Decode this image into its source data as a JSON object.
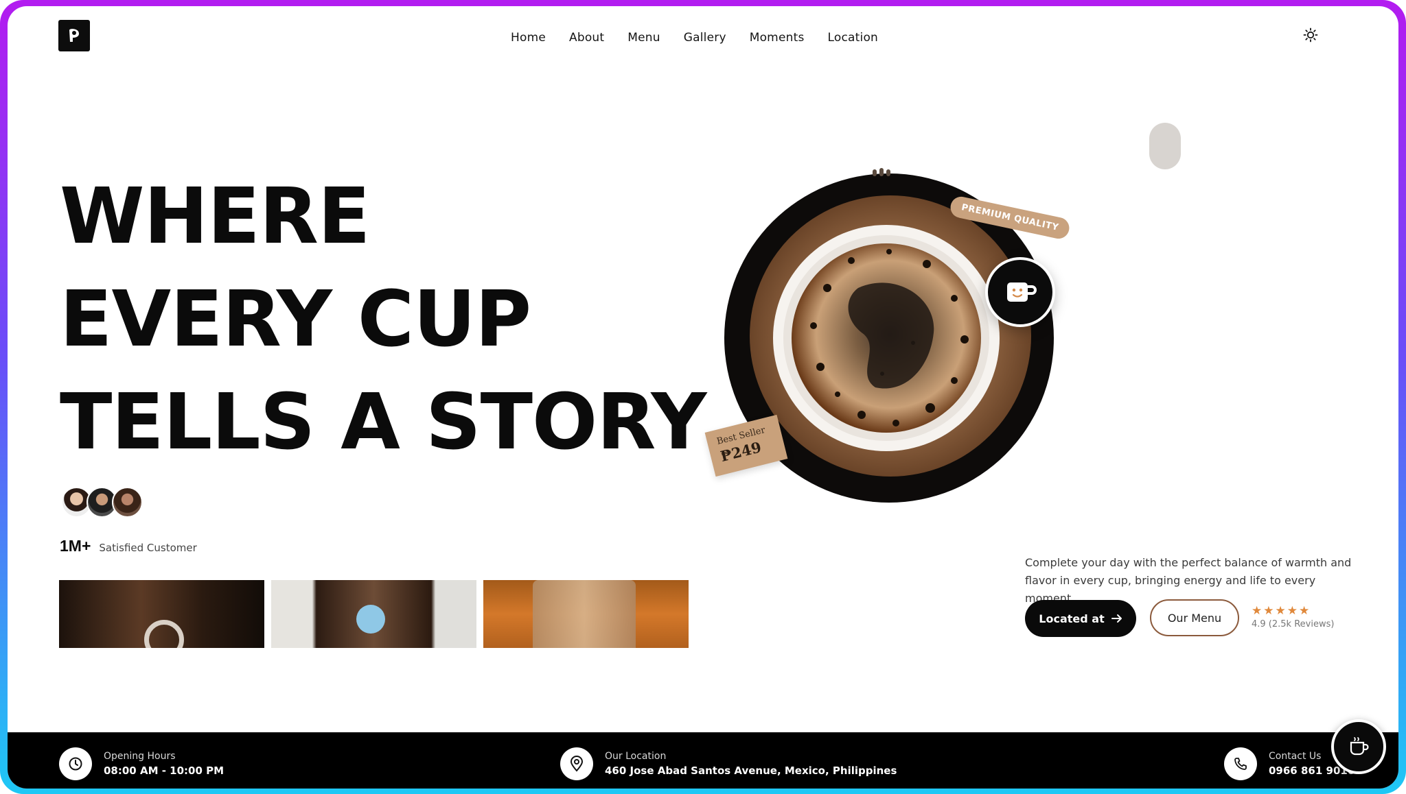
{
  "nav": {
    "items": [
      "Home",
      "About",
      "Menu",
      "Gallery",
      "Moments",
      "Location"
    ]
  },
  "hero": {
    "title_lines": [
      "WHERE",
      "EVERY CUP",
      "TELLS A STORY"
    ],
    "stat_number": "1M+",
    "stat_label": "Satisfied Customer"
  },
  "visual": {
    "premium_badge": "PREMIUM QUALITY",
    "bestseller_label": "Best Seller",
    "bestseller_price": "₱249"
  },
  "intro": {
    "description": "Complete your day with the perfect balance of warmth and flavor in every cup, bringing energy and life to every moment.",
    "located_button": "Located at",
    "menu_button": "Our Menu",
    "stars": "★★★★★",
    "rating_text": "4.9 (2.5k Reviews)"
  },
  "footer": {
    "hours_label": "Opening Hours",
    "hours_value": "08:00 AM - 10:00 PM",
    "location_label": "Our Location",
    "location_value": "460 Jose Abad Santos Avenue, Mexico, Philippines",
    "contact_label": "Contact Us",
    "contact_value": "0966 861 9010"
  },
  "colors": {
    "accent": "#c9a27e",
    "star": "#e0893c",
    "dark": "#0b0b0b"
  },
  "icons": {
    "logo": "coffee-logo-icon",
    "theme": "sun-icon",
    "mug": "mug-icon",
    "clock": "clock-icon",
    "pin": "map-pin-icon",
    "phone": "phone-icon",
    "arrow": "arrow-right-icon"
  }
}
